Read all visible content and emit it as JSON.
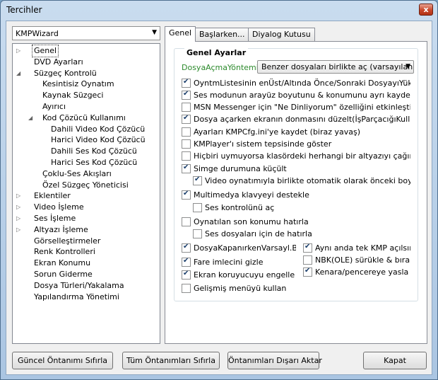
{
  "window": {
    "title": "Tercihler",
    "close_label": "x"
  },
  "profile": {
    "selected": "KMPWizard"
  },
  "tree": [
    {
      "label": "Genel",
      "depth": 0,
      "expander": "▷",
      "selected": true
    },
    {
      "label": "DVD Ayarları",
      "depth": 0,
      "expander": ""
    },
    {
      "label": "Süzgeç Kontrolü",
      "depth": 0,
      "expander": "◢"
    },
    {
      "label": "Kesintisiz Oynatım",
      "depth": 1,
      "expander": ""
    },
    {
      "label": "Kaynak Süzgeci",
      "depth": 1,
      "expander": ""
    },
    {
      "label": "Ayırıcı",
      "depth": 1,
      "expander": ""
    },
    {
      "label": "Kod Çözücü Kullanımı",
      "depth": 1,
      "expander": "◢"
    },
    {
      "label": "Dahili Video Kod Çözücü",
      "depth": 2,
      "expander": ""
    },
    {
      "label": "Harici Video Kod Çözücü",
      "depth": 2,
      "expander": ""
    },
    {
      "label": "Dahili Ses Kod Çözücü",
      "depth": 2,
      "expander": ""
    },
    {
      "label": "Harici Ses Kod Çözücü",
      "depth": 2,
      "expander": ""
    },
    {
      "label": "Çoklu-Ses Akışları",
      "depth": 1,
      "expander": ""
    },
    {
      "label": "Özel Süzgeç Yöneticisi",
      "depth": 1,
      "expander": ""
    },
    {
      "label": "Eklentiler",
      "depth": 0,
      "expander": "▷"
    },
    {
      "label": "Video İşleme",
      "depth": 0,
      "expander": "▷"
    },
    {
      "label": "Ses İşleme",
      "depth": 0,
      "expander": "▷"
    },
    {
      "label": "Altyazı İşleme",
      "depth": 0,
      "expander": "▷"
    },
    {
      "label": "Görselleştirmeler",
      "depth": 0,
      "expander": ""
    },
    {
      "label": "Renk Kontrolleri",
      "depth": 0,
      "expander": ""
    },
    {
      "label": "Ekran Konumu",
      "depth": 0,
      "expander": ""
    },
    {
      "label": "Sorun Giderme",
      "depth": 0,
      "expander": ""
    },
    {
      "label": "Dosya Türleri/Yakalama",
      "depth": 0,
      "expander": ""
    },
    {
      "label": "Yapılandırma Yönetimi",
      "depth": 0,
      "expander": ""
    }
  ],
  "tabs": [
    {
      "label": "Genel",
      "active": true
    },
    {
      "label": "Başlarken...",
      "active": false
    },
    {
      "label": "Diyalog Kutusu",
      "active": false
    }
  ],
  "general": {
    "group_title": "Genel Ayarlar",
    "open_method_label": "DosyaAçmaYöntemi:",
    "open_method_value": "Benzer dosyaları birlikte aç (varsayılan)",
    "options": [
      {
        "label": "OyntmListesinin enÜst/Altında Önce/Sonraki DosyayıYükle",
        "checked": true
      },
      {
        "label": "Ses modunun arayüz boyutunu & konumunu ayrı kaydet",
        "checked": true
      },
      {
        "label": "MSN Messenger için \"Ne Dinliyorum\" özelliğini etkinleştir",
        "checked": false
      },
      {
        "label": "Dosya açarken ekranın donmasını düzelt(İşParçacığıKullanar",
        "checked": true
      },
      {
        "label": "Ayarları KMPCfg.ini'ye kaydet (biraz yavaş)",
        "checked": false
      },
      {
        "label": "KMPlayer'ı sistem tepsisinde göster",
        "checked": false
      },
      {
        "label": "Hiçbiri uymuyorsa klasördeki herhangi bir altyazıyı çağır",
        "checked": false
      },
      {
        "label": "Simge durumuna küçült",
        "checked": true
      },
      {
        "label": "Video oynatımıyla birlikte otomatik olarak önceki boyut",
        "checked": true,
        "indent": true
      },
      {
        "label": "Multimedya klavyeyi destekle",
        "checked": true
      },
      {
        "label": "Ses kontrolünü aç",
        "checked": false,
        "indent": true
      },
      {
        "label": "Oynatılan son konumu hatırla",
        "checked": false
      },
      {
        "label": "Ses dosyaları için de hatırla",
        "checked": false,
        "indent": true
      }
    ],
    "left_options": [
      {
        "label": "DosyaKapanırkenVarsayl.Boy",
        "checked": true
      },
      {
        "label": "Fare imlecini gizle",
        "checked": true
      },
      {
        "label": "Ekran koruyucuyu engelle",
        "checked": true
      },
      {
        "label": "Gelişmiş menüyü kullan",
        "checked": false
      }
    ],
    "right_options": [
      {
        "label": "Aynı anda tek KMP açılsın",
        "checked": true
      },
      {
        "label": "NBK(OLE) sürükle & bırak",
        "checked": false
      },
      {
        "label": "Kenara/pencereye yasla",
        "checked": true
      }
    ]
  },
  "buttons": {
    "reset_current": "Güncel Öntanımı Sıfırla",
    "reset_all": "Tüm Öntanımları Sıfırla",
    "export": "Öntanımları Dışarı Aktar",
    "close": "Kapat"
  }
}
